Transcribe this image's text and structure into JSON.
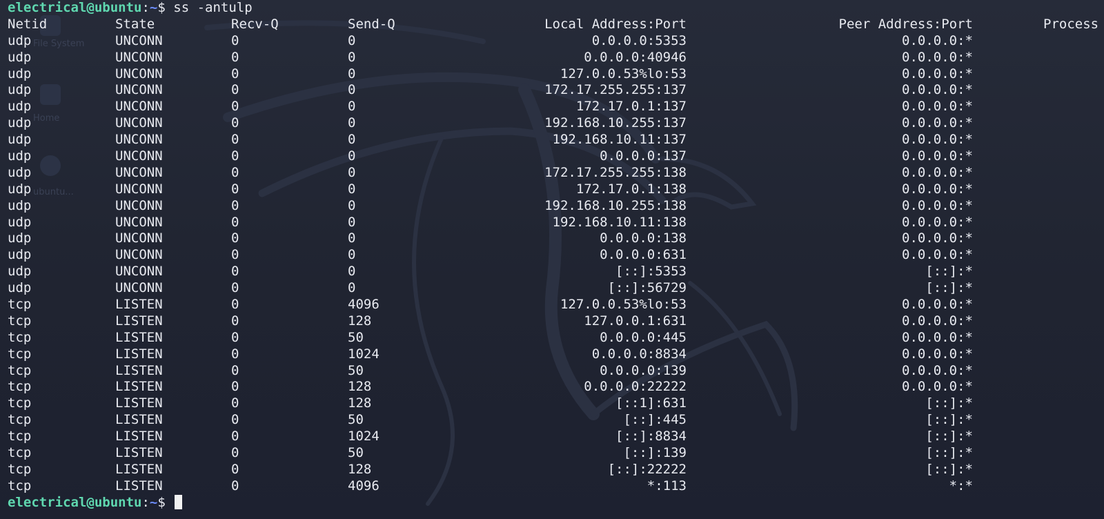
{
  "prompt": {
    "user_host": "electrical@ubuntu",
    "separator": ":",
    "path": "~",
    "dollar": "$ ",
    "command": "ss -antulp"
  },
  "columns": {
    "netid": "Netid",
    "state": "State",
    "recvq": "Recv-Q",
    "sendq": "Send-Q",
    "local": "Local Address:Port",
    "peer": "Peer Address:Port",
    "process": "Process"
  },
  "rows": [
    {
      "netid": "udp",
      "state": "UNCONN",
      "recvq": "0",
      "sendq": "0",
      "local": "0.0.0.0:5353",
      "peer": "0.0.0.0:*"
    },
    {
      "netid": "udp",
      "state": "UNCONN",
      "recvq": "0",
      "sendq": "0",
      "local": "0.0.0.0:40946",
      "peer": "0.0.0.0:*"
    },
    {
      "netid": "udp",
      "state": "UNCONN",
      "recvq": "0",
      "sendq": "0",
      "local": "127.0.0.53%lo:53",
      "peer": "0.0.0.0:*"
    },
    {
      "netid": "udp",
      "state": "UNCONN",
      "recvq": "0",
      "sendq": "0",
      "local": "172.17.255.255:137",
      "peer": "0.0.0.0:*"
    },
    {
      "netid": "udp",
      "state": "UNCONN",
      "recvq": "0",
      "sendq": "0",
      "local": "172.17.0.1:137",
      "peer": "0.0.0.0:*"
    },
    {
      "netid": "udp",
      "state": "UNCONN",
      "recvq": "0",
      "sendq": "0",
      "local": "192.168.10.255:137",
      "peer": "0.0.0.0:*"
    },
    {
      "netid": "udp",
      "state": "UNCONN",
      "recvq": "0",
      "sendq": "0",
      "local": "192.168.10.11:137",
      "peer": "0.0.0.0:*"
    },
    {
      "netid": "udp",
      "state": "UNCONN",
      "recvq": "0",
      "sendq": "0",
      "local": "0.0.0.0:137",
      "peer": "0.0.0.0:*"
    },
    {
      "netid": "udp",
      "state": "UNCONN",
      "recvq": "0",
      "sendq": "0",
      "local": "172.17.255.255:138",
      "peer": "0.0.0.0:*"
    },
    {
      "netid": "udp",
      "state": "UNCONN",
      "recvq": "0",
      "sendq": "0",
      "local": "172.17.0.1:138",
      "peer": "0.0.0.0:*"
    },
    {
      "netid": "udp",
      "state": "UNCONN",
      "recvq": "0",
      "sendq": "0",
      "local": "192.168.10.255:138",
      "peer": "0.0.0.0:*"
    },
    {
      "netid": "udp",
      "state": "UNCONN",
      "recvq": "0",
      "sendq": "0",
      "local": "192.168.10.11:138",
      "peer": "0.0.0.0:*"
    },
    {
      "netid": "udp",
      "state": "UNCONN",
      "recvq": "0",
      "sendq": "0",
      "local": "0.0.0.0:138",
      "peer": "0.0.0.0:*"
    },
    {
      "netid": "udp",
      "state": "UNCONN",
      "recvq": "0",
      "sendq": "0",
      "local": "0.0.0.0:631",
      "peer": "0.0.0.0:*"
    },
    {
      "netid": "udp",
      "state": "UNCONN",
      "recvq": "0",
      "sendq": "0",
      "local": "[::]:5353",
      "peer": "[::]:*"
    },
    {
      "netid": "udp",
      "state": "UNCONN",
      "recvq": "0",
      "sendq": "0",
      "local": "[::]:56729",
      "peer": "[::]:*"
    },
    {
      "netid": "tcp",
      "state": "LISTEN",
      "recvq": "0",
      "sendq": "4096",
      "local": "127.0.0.53%lo:53",
      "peer": "0.0.0.0:*"
    },
    {
      "netid": "tcp",
      "state": "LISTEN",
      "recvq": "0",
      "sendq": "128",
      "local": "127.0.0.1:631",
      "peer": "0.0.0.0:*"
    },
    {
      "netid": "tcp",
      "state": "LISTEN",
      "recvq": "0",
      "sendq": "50",
      "local": "0.0.0.0:445",
      "peer": "0.0.0.0:*"
    },
    {
      "netid": "tcp",
      "state": "LISTEN",
      "recvq": "0",
      "sendq": "1024",
      "local": "0.0.0.0:8834",
      "peer": "0.0.0.0:*"
    },
    {
      "netid": "tcp",
      "state": "LISTEN",
      "recvq": "0",
      "sendq": "50",
      "local": "0.0.0.0:139",
      "peer": "0.0.0.0:*"
    },
    {
      "netid": "tcp",
      "state": "LISTEN",
      "recvq": "0",
      "sendq": "128",
      "local": "0.0.0.0:22222",
      "peer": "0.0.0.0:*"
    },
    {
      "netid": "tcp",
      "state": "LISTEN",
      "recvq": "0",
      "sendq": "128",
      "local": "[::1]:631",
      "peer": "[::]:*"
    },
    {
      "netid": "tcp",
      "state": "LISTEN",
      "recvq": "0",
      "sendq": "50",
      "local": "[::]:445",
      "peer": "[::]:*"
    },
    {
      "netid": "tcp",
      "state": "LISTEN",
      "recvq": "0",
      "sendq": "1024",
      "local": "[::]:8834",
      "peer": "[::]:*"
    },
    {
      "netid": "tcp",
      "state": "LISTEN",
      "recvq": "0",
      "sendq": "50",
      "local": "[::]:139",
      "peer": "[::]:*"
    },
    {
      "netid": "tcp",
      "state": "LISTEN",
      "recvq": "0",
      "sendq": "128",
      "local": "[::]:22222",
      "peer": "[::]:*"
    },
    {
      "netid": "tcp",
      "state": "LISTEN",
      "recvq": "0",
      "sendq": "4096",
      "local": "*:113",
      "peer": "*:*"
    }
  ],
  "colors": {
    "background": "#232836",
    "foreground": "#e8eaf0",
    "prompt_user": "#5fd7af",
    "prompt_path": "#6c8cff",
    "cursor": "#f2f2f2"
  }
}
